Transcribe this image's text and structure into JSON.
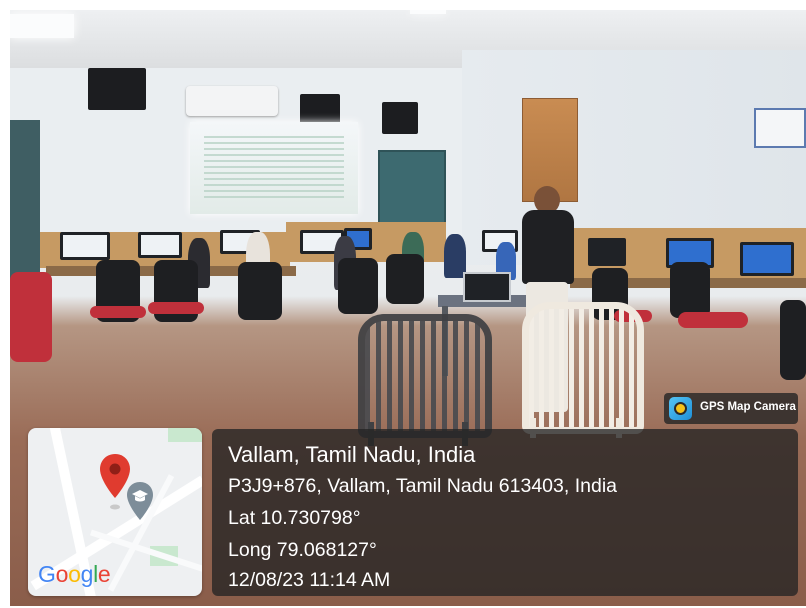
{
  "location": {
    "title": "Vallam, Tamil Nadu, India",
    "address": "P3J9+876, Vallam, Tamil Nadu 613403, India",
    "latitude": "Lat 10.730798°",
    "longitude": "Long 79.068127°",
    "datetime": "12/08/23 11:14 AM"
  },
  "map": {
    "provider_logo": "Google",
    "marker_icon": "map-pin-icon",
    "poi_icon": "graduation-cap-icon"
  },
  "badge": {
    "app_name": "GPS Map Camera",
    "icon": "camera-lens-icon"
  },
  "colors": {
    "pin_red": "#e03b2f",
    "card_background": "#242424",
    "google_blue": "#4285f4",
    "google_red": "#ea4335",
    "google_yellow": "#fbbc05",
    "google_green": "#34a853"
  }
}
